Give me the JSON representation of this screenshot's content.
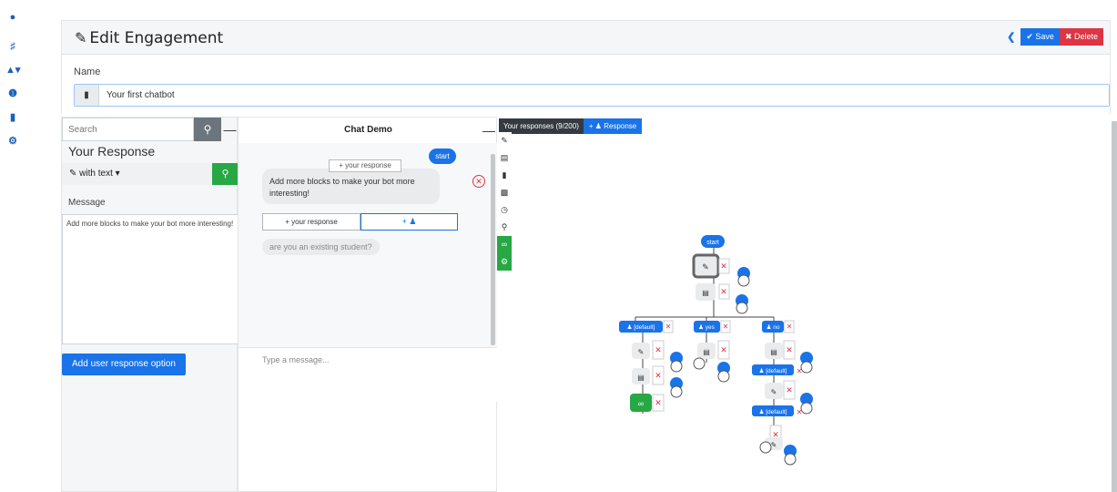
{
  "sidebar": {
    "icons": [
      "dashboard-icon",
      "sitemap-icon",
      "binoculars-icon",
      "info-icon",
      "file-icon",
      "cogs-icon"
    ]
  },
  "header": {
    "title": "Edit Engagement",
    "save_label": "Save",
    "delete_label": "Delete"
  },
  "name_field": {
    "label": "Name",
    "value": "Your first chatbot"
  },
  "left_panel": {
    "search_placeholder": "Search",
    "heading": "Your Response",
    "response_type": "with text",
    "message_label": "Message",
    "message_value": "Add more blocks to make your bot more interesting!",
    "add_option_label": "Add user response option"
  },
  "chat": {
    "title": "Chat Demo",
    "start_bubble": "start",
    "ghost_response": "your response",
    "bot_message": "Add more blocks to make your bot more interesting!",
    "response_option": "your response",
    "question": "are you an existing student?",
    "input_placeholder": "Type a message..."
  },
  "canvas": {
    "responses_tab": "Your responses (9/200)",
    "add_response": "Response",
    "tree": {
      "start": "start",
      "branch_default": "[default]",
      "branch_yes": "yes",
      "branch_no": "no",
      "sub_default_1": "[default]",
      "sub_default_2": "[default]"
    }
  },
  "colors": {
    "accent": "#1a73e8",
    "danger": "#dc3545",
    "success": "#28a745"
  }
}
